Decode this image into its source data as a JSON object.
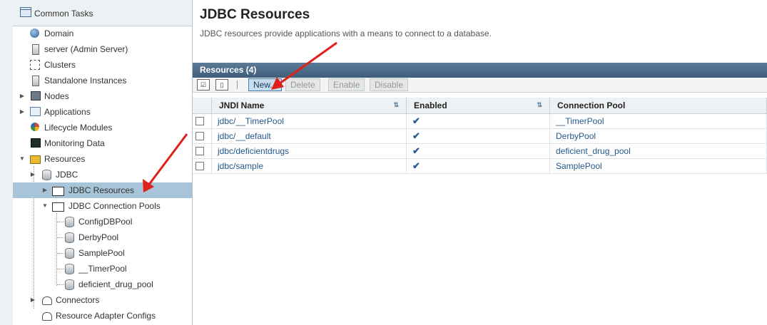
{
  "sidebar": {
    "common_tasks": "Common Tasks",
    "items": [
      {
        "label": "Domain",
        "icon": "globe-icon"
      },
      {
        "label": "server (Admin Server)",
        "icon": "server-icon"
      },
      {
        "label": "Clusters",
        "icon": "cluster-icon"
      },
      {
        "label": "Standalone Instances",
        "icon": "server-icon"
      },
      {
        "label": "Nodes",
        "icon": "node-icon"
      },
      {
        "label": "Applications",
        "icon": "applications-icon"
      },
      {
        "label": "Lifecycle Modules",
        "icon": "lifecycle-icon"
      },
      {
        "label": "Monitoring Data",
        "icon": "monitor-icon"
      },
      {
        "label": "Resources",
        "icon": "resources-icon"
      },
      {
        "label": "JDBC",
        "icon": "database-icon"
      },
      {
        "label": "JDBC Resources",
        "icon": "folder-icon"
      },
      {
        "label": "JDBC Connection Pools",
        "icon": "folder-icon"
      },
      {
        "label": "ConfigDBPool",
        "icon": "database-icon"
      },
      {
        "label": "DerbyPool",
        "icon": "database-icon"
      },
      {
        "label": "SamplePool",
        "icon": "database-icon"
      },
      {
        "label": "__TimerPool",
        "icon": "database-icon"
      },
      {
        "label": "deficient_drug_pool",
        "icon": "database-icon"
      },
      {
        "label": "Connectors",
        "icon": "connector-icon"
      },
      {
        "label": "Resource Adapter Configs",
        "icon": "connector-icon"
      }
    ]
  },
  "main": {
    "title": "JDBC Resources",
    "description": "JDBC resources provide applications with a means to connect to a database.",
    "table_title": "Resources (4)",
    "toolbar": {
      "new_label": "New...",
      "delete_label": "Delete",
      "enable_label": "Enable",
      "disable_label": "Disable"
    },
    "columns": {
      "jndi_name": "JNDI Name",
      "enabled": "Enabled",
      "connection_pool": "Connection Pool"
    },
    "rows": [
      {
        "jndi": "jdbc/__TimerPool",
        "enabled": "✔",
        "pool": "__TimerPool"
      },
      {
        "jndi": "jdbc/__default",
        "enabled": "✔",
        "pool": "DerbyPool"
      },
      {
        "jndi": "jdbc/deficientdrugs",
        "enabled": "✔",
        "pool": "deficient_drug_pool"
      },
      {
        "jndi": "jdbc/sample",
        "enabled": "✔",
        "pool": "SamplePool"
      }
    ]
  },
  "colors": {
    "selected_row": "#a8c4d8",
    "header_bar": "#4a6a88",
    "link": "#23588c",
    "annotation_arrow": "#e0201a"
  }
}
